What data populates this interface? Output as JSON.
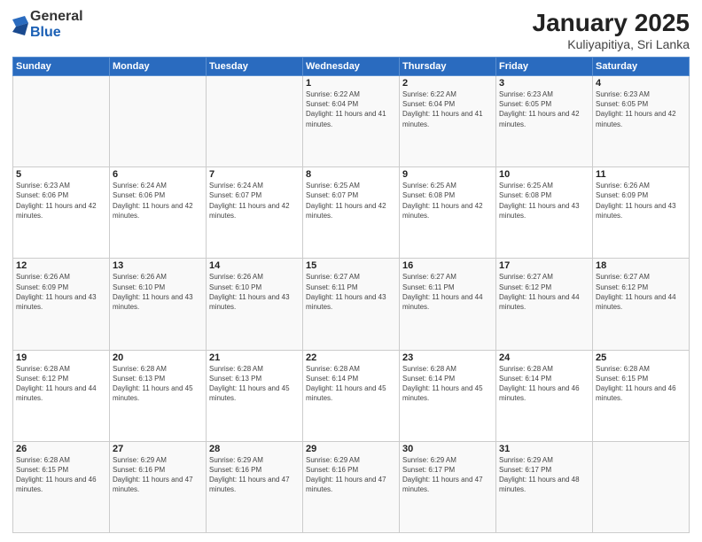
{
  "header": {
    "logo": {
      "line1": "General",
      "line2": "Blue"
    },
    "title": "January 2025",
    "location": "Kuliyapitiya, Sri Lanka"
  },
  "weekdays": [
    "Sunday",
    "Monday",
    "Tuesday",
    "Wednesday",
    "Thursday",
    "Friday",
    "Saturday"
  ],
  "weeks": [
    [
      {
        "day": "",
        "sunrise": "",
        "sunset": "",
        "daylight": ""
      },
      {
        "day": "",
        "sunrise": "",
        "sunset": "",
        "daylight": ""
      },
      {
        "day": "",
        "sunrise": "",
        "sunset": "",
        "daylight": ""
      },
      {
        "day": "1",
        "sunrise": "6:22 AM",
        "sunset": "6:04 PM",
        "daylight": "11 hours and 41 minutes."
      },
      {
        "day": "2",
        "sunrise": "6:22 AM",
        "sunset": "6:04 PM",
        "daylight": "11 hours and 41 minutes."
      },
      {
        "day": "3",
        "sunrise": "6:23 AM",
        "sunset": "6:05 PM",
        "daylight": "11 hours and 42 minutes."
      },
      {
        "day": "4",
        "sunrise": "6:23 AM",
        "sunset": "6:05 PM",
        "daylight": "11 hours and 42 minutes."
      }
    ],
    [
      {
        "day": "5",
        "sunrise": "6:23 AM",
        "sunset": "6:06 PM",
        "daylight": "11 hours and 42 minutes."
      },
      {
        "day": "6",
        "sunrise": "6:24 AM",
        "sunset": "6:06 PM",
        "daylight": "11 hours and 42 minutes."
      },
      {
        "day": "7",
        "sunrise": "6:24 AM",
        "sunset": "6:07 PM",
        "daylight": "11 hours and 42 minutes."
      },
      {
        "day": "8",
        "sunrise": "6:25 AM",
        "sunset": "6:07 PM",
        "daylight": "11 hours and 42 minutes."
      },
      {
        "day": "9",
        "sunrise": "6:25 AM",
        "sunset": "6:08 PM",
        "daylight": "11 hours and 42 minutes."
      },
      {
        "day": "10",
        "sunrise": "6:25 AM",
        "sunset": "6:08 PM",
        "daylight": "11 hours and 43 minutes."
      },
      {
        "day": "11",
        "sunrise": "6:26 AM",
        "sunset": "6:09 PM",
        "daylight": "11 hours and 43 minutes."
      }
    ],
    [
      {
        "day": "12",
        "sunrise": "6:26 AM",
        "sunset": "6:09 PM",
        "daylight": "11 hours and 43 minutes."
      },
      {
        "day": "13",
        "sunrise": "6:26 AM",
        "sunset": "6:10 PM",
        "daylight": "11 hours and 43 minutes."
      },
      {
        "day": "14",
        "sunrise": "6:26 AM",
        "sunset": "6:10 PM",
        "daylight": "11 hours and 43 minutes."
      },
      {
        "day": "15",
        "sunrise": "6:27 AM",
        "sunset": "6:11 PM",
        "daylight": "11 hours and 43 minutes."
      },
      {
        "day": "16",
        "sunrise": "6:27 AM",
        "sunset": "6:11 PM",
        "daylight": "11 hours and 44 minutes."
      },
      {
        "day": "17",
        "sunrise": "6:27 AM",
        "sunset": "6:12 PM",
        "daylight": "11 hours and 44 minutes."
      },
      {
        "day": "18",
        "sunrise": "6:27 AM",
        "sunset": "6:12 PM",
        "daylight": "11 hours and 44 minutes."
      }
    ],
    [
      {
        "day": "19",
        "sunrise": "6:28 AM",
        "sunset": "6:12 PM",
        "daylight": "11 hours and 44 minutes."
      },
      {
        "day": "20",
        "sunrise": "6:28 AM",
        "sunset": "6:13 PM",
        "daylight": "11 hours and 45 minutes."
      },
      {
        "day": "21",
        "sunrise": "6:28 AM",
        "sunset": "6:13 PM",
        "daylight": "11 hours and 45 minutes."
      },
      {
        "day": "22",
        "sunrise": "6:28 AM",
        "sunset": "6:14 PM",
        "daylight": "11 hours and 45 minutes."
      },
      {
        "day": "23",
        "sunrise": "6:28 AM",
        "sunset": "6:14 PM",
        "daylight": "11 hours and 45 minutes."
      },
      {
        "day": "24",
        "sunrise": "6:28 AM",
        "sunset": "6:14 PM",
        "daylight": "11 hours and 46 minutes."
      },
      {
        "day": "25",
        "sunrise": "6:28 AM",
        "sunset": "6:15 PM",
        "daylight": "11 hours and 46 minutes."
      }
    ],
    [
      {
        "day": "26",
        "sunrise": "6:28 AM",
        "sunset": "6:15 PM",
        "daylight": "11 hours and 46 minutes."
      },
      {
        "day": "27",
        "sunrise": "6:29 AM",
        "sunset": "6:16 PM",
        "daylight": "11 hours and 47 minutes."
      },
      {
        "day": "28",
        "sunrise": "6:29 AM",
        "sunset": "6:16 PM",
        "daylight": "11 hours and 47 minutes."
      },
      {
        "day": "29",
        "sunrise": "6:29 AM",
        "sunset": "6:16 PM",
        "daylight": "11 hours and 47 minutes."
      },
      {
        "day": "30",
        "sunrise": "6:29 AM",
        "sunset": "6:17 PM",
        "daylight": "11 hours and 47 minutes."
      },
      {
        "day": "31",
        "sunrise": "6:29 AM",
        "sunset": "6:17 PM",
        "daylight": "11 hours and 48 minutes."
      },
      {
        "day": "",
        "sunrise": "",
        "sunset": "",
        "daylight": ""
      }
    ]
  ]
}
